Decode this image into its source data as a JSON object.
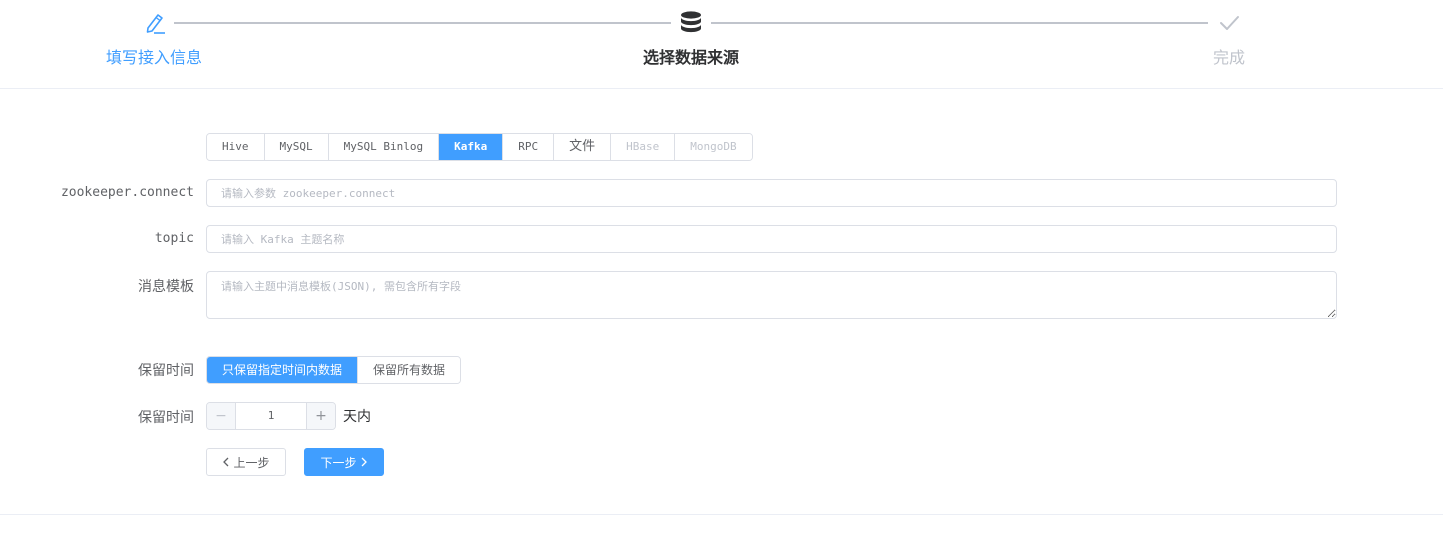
{
  "steps": [
    {
      "title": "填写接入信息",
      "icon": "edit-icon",
      "status": "done"
    },
    {
      "title": "选择数据来源",
      "icon": "database-icon",
      "status": "current"
    },
    {
      "title": "完成",
      "icon": "check-icon",
      "status": "pending"
    }
  ],
  "source_tabs": [
    {
      "label": "Hive",
      "state": "normal"
    },
    {
      "label": "MySQL",
      "state": "normal"
    },
    {
      "label": "MySQL Binlog",
      "state": "normal"
    },
    {
      "label": "Kafka",
      "state": "active"
    },
    {
      "label": "RPC",
      "state": "normal"
    },
    {
      "label": "文件",
      "state": "normal"
    },
    {
      "label": "HBase",
      "state": "disabled"
    },
    {
      "label": "MongoDB",
      "state": "disabled"
    }
  ],
  "form": {
    "zookeeper": {
      "label": "zookeeper.connect",
      "value": "",
      "placeholder": "请输入参数 zookeeper.connect"
    },
    "topic": {
      "label": "topic",
      "value": "",
      "placeholder": "请输入 Kafka 主题名称"
    },
    "template": {
      "label": "消息模板",
      "value": "",
      "placeholder": "请输入主题中消息模板(JSON), 需包含所有字段"
    },
    "retention_mode": {
      "label": "保留时间",
      "options": [
        "只保留指定时间内数据",
        "保留所有数据"
      ],
      "selected": "只保留指定时间内数据"
    },
    "retention_days": {
      "label": "保留时间",
      "value": "1",
      "minus": "−",
      "plus": "+",
      "unit": "天内"
    }
  },
  "actions": {
    "prev": "上一步",
    "next": "下一步"
  },
  "colors": {
    "primary": "#409eff",
    "border": "#dcdfe6",
    "disabled_text": "#c0c4cc"
  }
}
